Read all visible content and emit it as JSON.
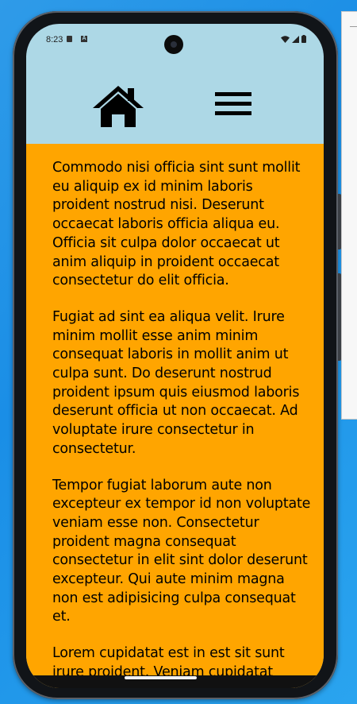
{
  "status_bar": {
    "time": "8:23",
    "icons": [
      "sd-card-icon",
      "a-icon",
      "wifi-icon",
      "signal-icon",
      "battery-icon"
    ]
  },
  "header": {
    "home_icon": "home-icon",
    "menu_icon": "hamburger-menu-icon",
    "background_color": "#add8e6"
  },
  "content": {
    "background_color": "#ffa500",
    "paragraphs": [
      "Commodo nisi officia sint sunt mollit eu aliquip ex id minim laboris proident nostrud nisi. Deserunt occaecat laboris officia aliqua eu. Officia sit culpa dolor occaecat ut anim aliquip in proident occaecat consectetur do elit officia.",
      "Fugiat ad sint ea aliqua velit. Irure minim mollit esse anim minim consequat laboris in mollit anim ut culpa sunt. Do deserunt nostrud proident ipsum quis eiusmod laboris deserunt officia ut non occaecat. Ad voluptate irure consectetur in consectetur.",
      "Tempor fugiat laborum aute non excepteur ex tempor id non voluptate veniam esse non. Consectetur proident magna consequat consectetur in elit sint dolor deserunt excepteur. Qui aute minim magna non est adipisicing culpa consequat et.",
      "Lorem cupidatat est in est sit sunt irure proident. Veniam cupidatat veniam excepteur magna ullamco"
    ]
  }
}
